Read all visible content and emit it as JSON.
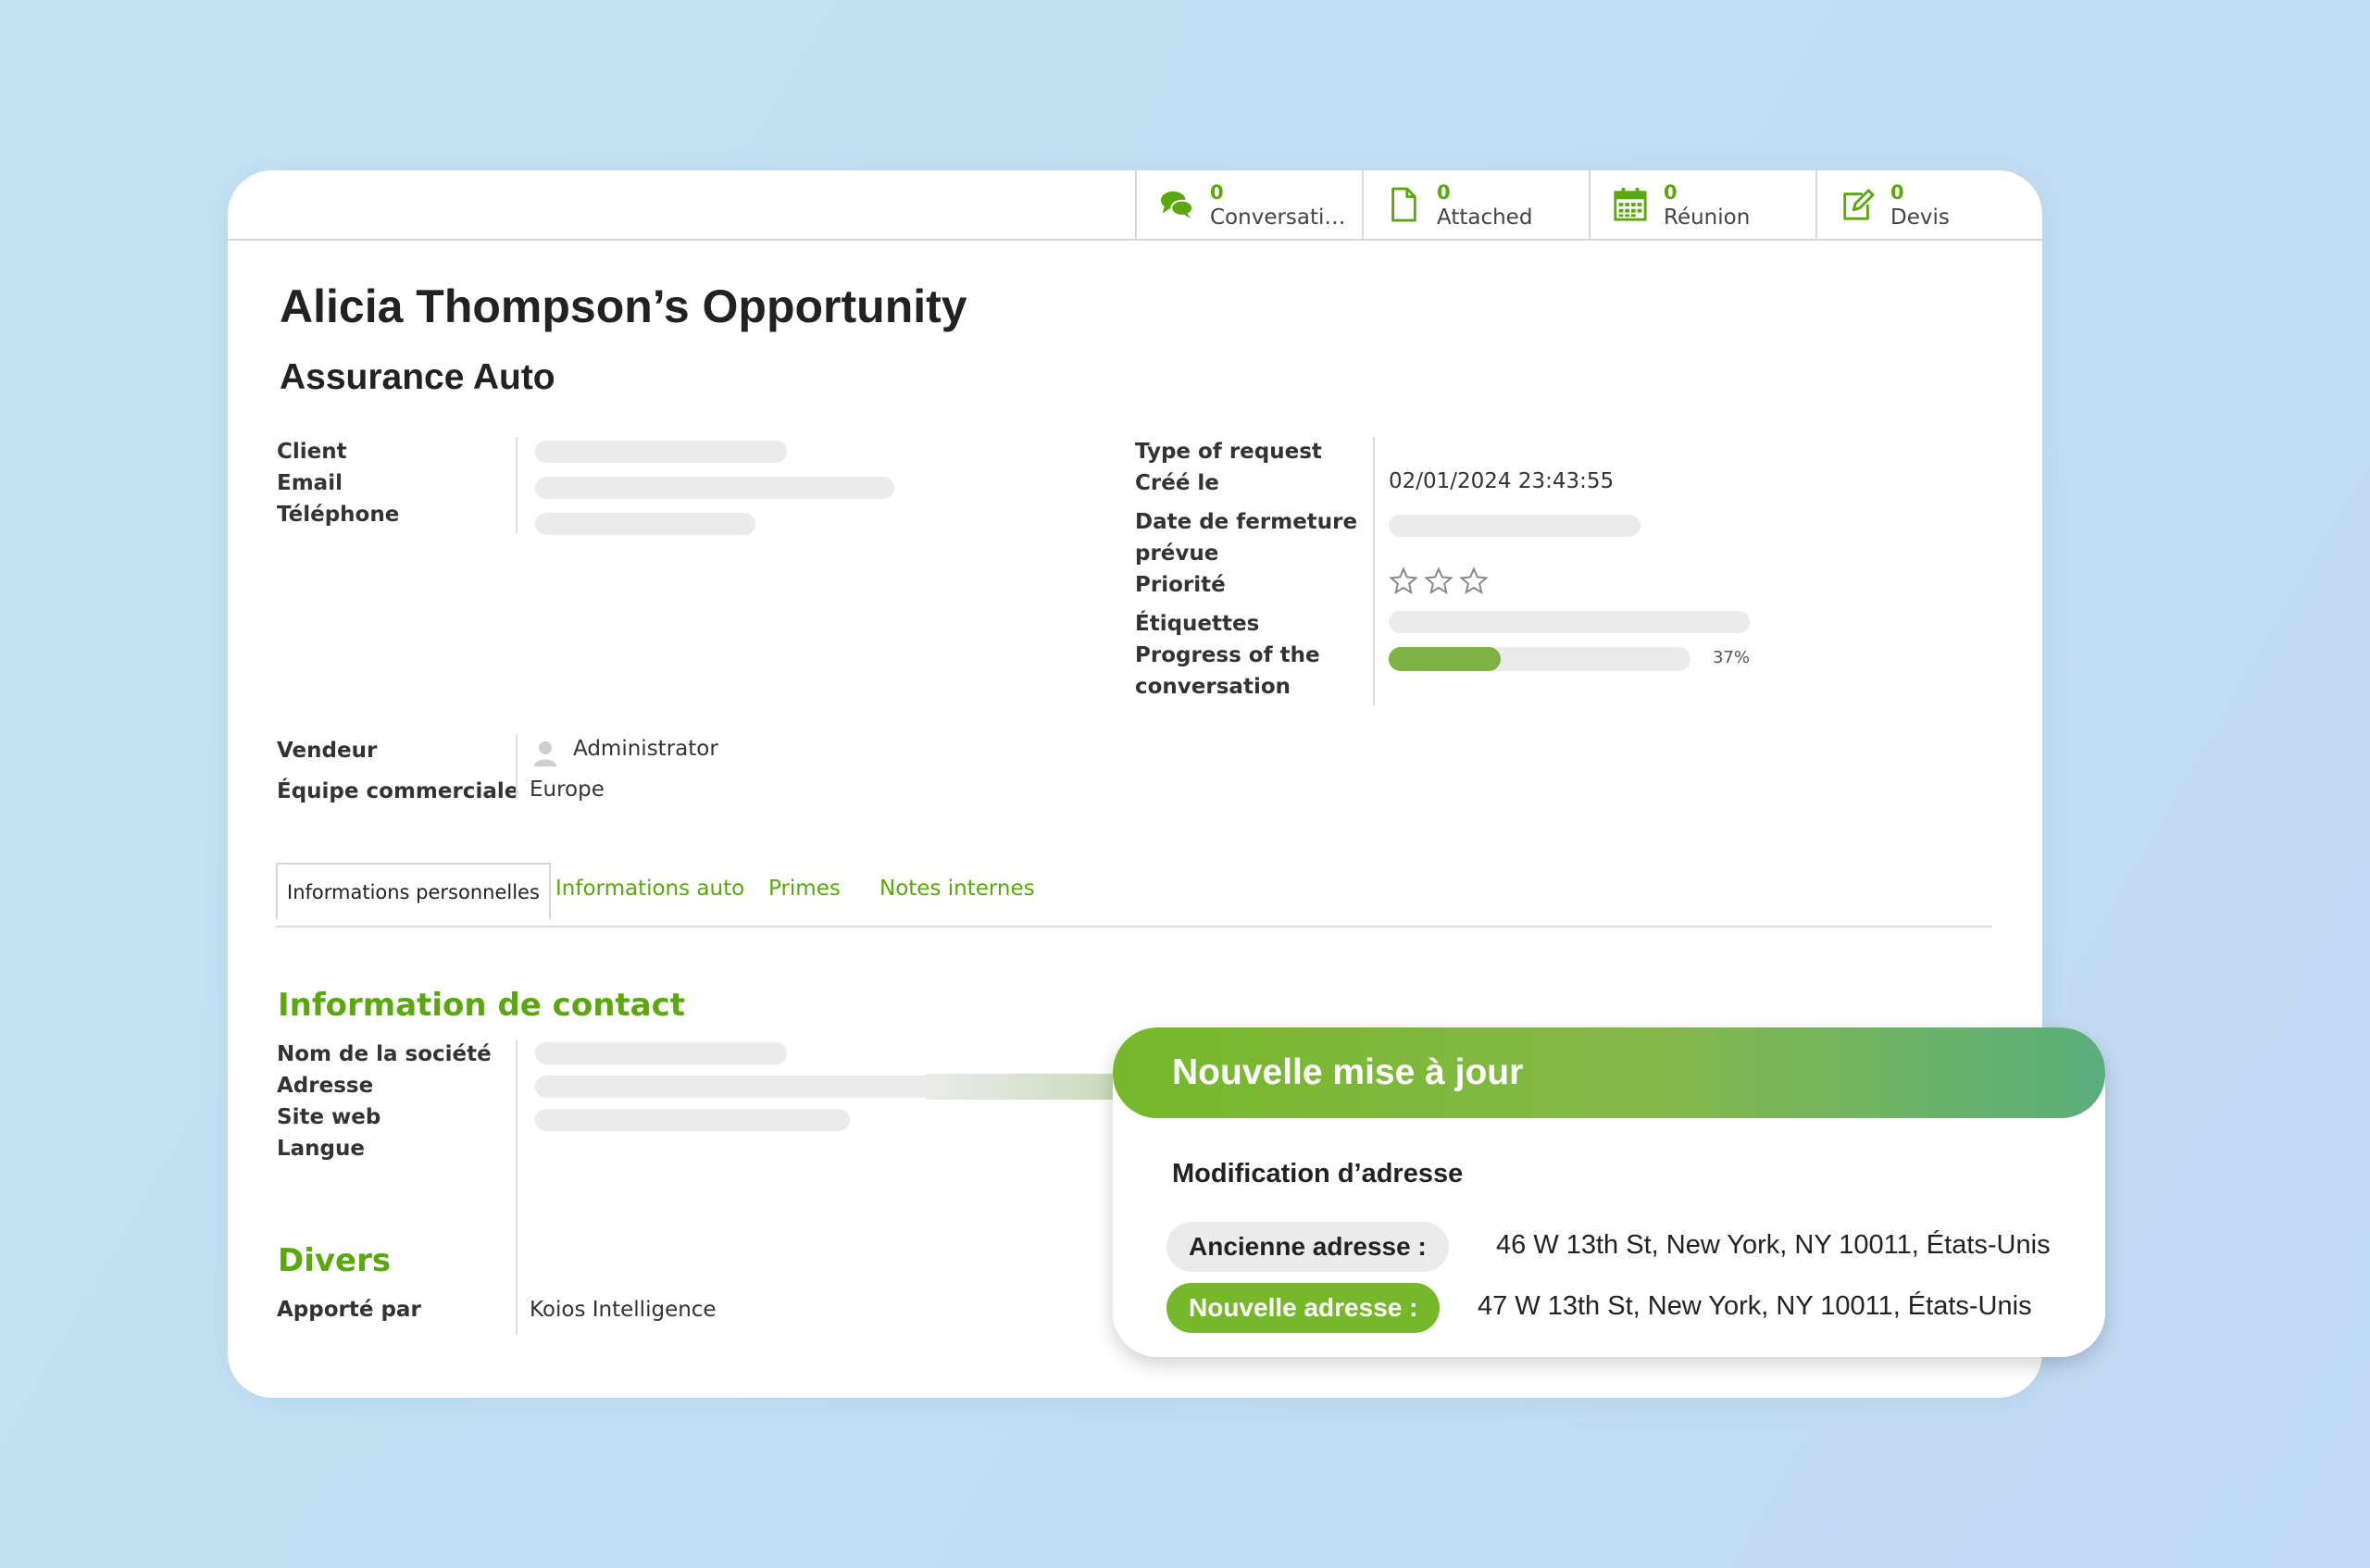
{
  "stat_buttons": [
    {
      "count": "0",
      "label": "Conversatio...",
      "icon": "chat-icon"
    },
    {
      "count": "0",
      "label": "Attached",
      "icon": "document-icon"
    },
    {
      "count": "0",
      "label": "Réunion",
      "icon": "calendar-icon"
    },
    {
      "count": "0",
      "label": "Devis",
      "icon": "edit-icon"
    }
  ],
  "record": {
    "title": "Alicia Thompson’s Opportunity",
    "subtitle": "Assurance Auto"
  },
  "left_fields": {
    "client_label": "Client",
    "email_label": "Email",
    "phone_label": "Téléphone"
  },
  "right_fields": {
    "type_label": "Type of request",
    "created_label": "Créé le",
    "created_value": "02/01/2024 23:43:55",
    "closing_label_1": "Date de fermeture",
    "closing_label_2": "prévue",
    "priority_label": "Priorité",
    "priority_stars": 0,
    "tags_label": "Étiquettes",
    "progress_label_1": "Progress of the",
    "progress_label_2": "conversation",
    "progress_value": 0.37,
    "progress_text": "37%"
  },
  "sales": {
    "seller_label": "Vendeur",
    "seller_value": "Administrator",
    "team_label": "Équipe commerciale",
    "team_value": "Europe"
  },
  "tabs": [
    {
      "label": "Informations personnelles",
      "active": true
    },
    {
      "label": "Informations auto",
      "active": false
    },
    {
      "label": "Primes",
      "active": false
    },
    {
      "label": "Notes internes",
      "active": false
    }
  ],
  "contact_section": {
    "title": "Information de contact",
    "company_label": "Nom de la société",
    "address_label": "Adresse",
    "website_label": "Site web",
    "language_label": "Langue"
  },
  "misc_section": {
    "title": "Divers",
    "brought_by_label": "Apporté par",
    "brought_by_value": "Koios Intelligence"
  },
  "notification": {
    "title": "Nouvelle mise à jour",
    "subtitle": "Modification d’adresse",
    "old_label": "Ancienne adresse :",
    "old_value": "46 W 13th St, New York, NY 10011, États-Unis",
    "new_label": "Nouvelle adresse :",
    "new_value": "47 W 13th St, New York, NY 10011, États-Unis"
  },
  "colors": {
    "accent": "#5aa70e",
    "progress": "#7cb342",
    "placeholder": "#ebebeb",
    "background": "#c3e3f4"
  }
}
